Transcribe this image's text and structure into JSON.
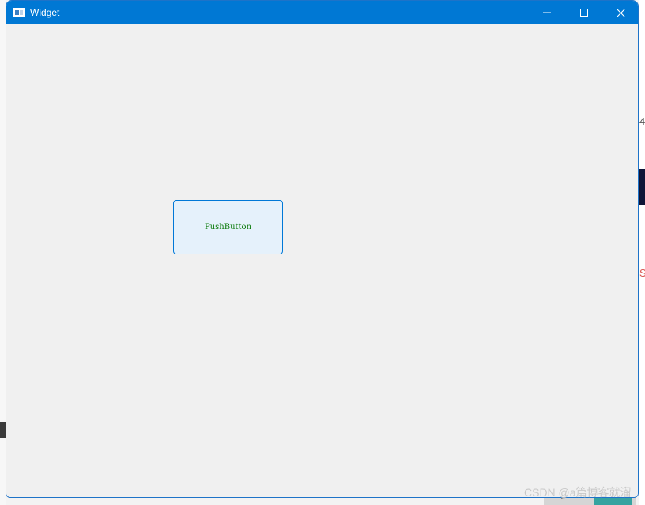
{
  "window": {
    "title": "Widget",
    "icon": "app-window-icon",
    "title_bar_color": "#0078d4",
    "controls": {
      "minimize_icon": "minimize-icon",
      "maximize_icon": "maximize-icon",
      "close_icon": "close-icon"
    }
  },
  "client": {
    "background": "#f0f0f0",
    "push_button": {
      "label": "PushButton",
      "text_color": "#0a7a0a",
      "border_color": "#0078d7",
      "background": "#e5f1fb"
    }
  },
  "background": {
    "fragments": [
      "4",
      "S"
    ],
    "watermark": "CSDN @a篇博客就溜"
  }
}
